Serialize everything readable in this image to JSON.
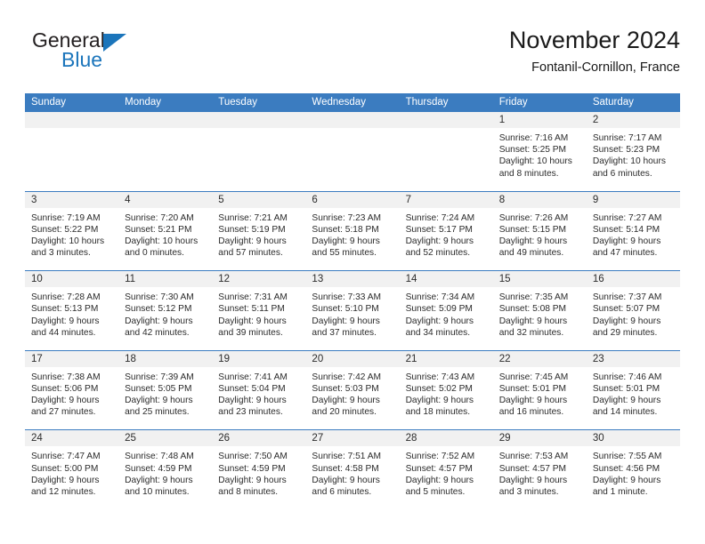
{
  "brand": {
    "name_part1": "General",
    "name_part2": "Blue",
    "accent_color": "#1b75bb",
    "logo_icon": "triangle-flag-icon"
  },
  "header": {
    "title": "November 2024",
    "subtitle": "Fontanil-Cornillon, France"
  },
  "theme": {
    "header_blue": "#3b7cc0",
    "day_band_gray": "#f1f1f1",
    "text": "#2b2b2b"
  },
  "weekdays": [
    "Sunday",
    "Monday",
    "Tuesday",
    "Wednesday",
    "Thursday",
    "Friday",
    "Saturday"
  ],
  "weeks": [
    [
      {
        "day": "",
        "empty": true
      },
      {
        "day": "",
        "empty": true
      },
      {
        "day": "",
        "empty": true
      },
      {
        "day": "",
        "empty": true
      },
      {
        "day": "",
        "empty": true
      },
      {
        "day": "1",
        "sunrise": "Sunrise: 7:16 AM",
        "sunset": "Sunset: 5:25 PM",
        "daylight_line1": "Daylight: 10 hours",
        "daylight_line2": "and 8 minutes."
      },
      {
        "day": "2",
        "sunrise": "Sunrise: 7:17 AM",
        "sunset": "Sunset: 5:23 PM",
        "daylight_line1": "Daylight: 10 hours",
        "daylight_line2": "and 6 minutes."
      }
    ],
    [
      {
        "day": "3",
        "sunrise": "Sunrise: 7:19 AM",
        "sunset": "Sunset: 5:22 PM",
        "daylight_line1": "Daylight: 10 hours",
        "daylight_line2": "and 3 minutes."
      },
      {
        "day": "4",
        "sunrise": "Sunrise: 7:20 AM",
        "sunset": "Sunset: 5:21 PM",
        "daylight_line1": "Daylight: 10 hours",
        "daylight_line2": "and 0 minutes."
      },
      {
        "day": "5",
        "sunrise": "Sunrise: 7:21 AM",
        "sunset": "Sunset: 5:19 PM",
        "daylight_line1": "Daylight: 9 hours",
        "daylight_line2": "and 57 minutes."
      },
      {
        "day": "6",
        "sunrise": "Sunrise: 7:23 AM",
        "sunset": "Sunset: 5:18 PM",
        "daylight_line1": "Daylight: 9 hours",
        "daylight_line2": "and 55 minutes."
      },
      {
        "day": "7",
        "sunrise": "Sunrise: 7:24 AM",
        "sunset": "Sunset: 5:17 PM",
        "daylight_line1": "Daylight: 9 hours",
        "daylight_line2": "and 52 minutes."
      },
      {
        "day": "8",
        "sunrise": "Sunrise: 7:26 AM",
        "sunset": "Sunset: 5:15 PM",
        "daylight_line1": "Daylight: 9 hours",
        "daylight_line2": "and 49 minutes."
      },
      {
        "day": "9",
        "sunrise": "Sunrise: 7:27 AM",
        "sunset": "Sunset: 5:14 PM",
        "daylight_line1": "Daylight: 9 hours",
        "daylight_line2": "and 47 minutes."
      }
    ],
    [
      {
        "day": "10",
        "sunrise": "Sunrise: 7:28 AM",
        "sunset": "Sunset: 5:13 PM",
        "daylight_line1": "Daylight: 9 hours",
        "daylight_line2": "and 44 minutes."
      },
      {
        "day": "11",
        "sunrise": "Sunrise: 7:30 AM",
        "sunset": "Sunset: 5:12 PM",
        "daylight_line1": "Daylight: 9 hours",
        "daylight_line2": "and 42 minutes."
      },
      {
        "day": "12",
        "sunrise": "Sunrise: 7:31 AM",
        "sunset": "Sunset: 5:11 PM",
        "daylight_line1": "Daylight: 9 hours",
        "daylight_line2": "and 39 minutes."
      },
      {
        "day": "13",
        "sunrise": "Sunrise: 7:33 AM",
        "sunset": "Sunset: 5:10 PM",
        "daylight_line1": "Daylight: 9 hours",
        "daylight_line2": "and 37 minutes."
      },
      {
        "day": "14",
        "sunrise": "Sunrise: 7:34 AM",
        "sunset": "Sunset: 5:09 PM",
        "daylight_line1": "Daylight: 9 hours",
        "daylight_line2": "and 34 minutes."
      },
      {
        "day": "15",
        "sunrise": "Sunrise: 7:35 AM",
        "sunset": "Sunset: 5:08 PM",
        "daylight_line1": "Daylight: 9 hours",
        "daylight_line2": "and 32 minutes."
      },
      {
        "day": "16",
        "sunrise": "Sunrise: 7:37 AM",
        "sunset": "Sunset: 5:07 PM",
        "daylight_line1": "Daylight: 9 hours",
        "daylight_line2": "and 29 minutes."
      }
    ],
    [
      {
        "day": "17",
        "sunrise": "Sunrise: 7:38 AM",
        "sunset": "Sunset: 5:06 PM",
        "daylight_line1": "Daylight: 9 hours",
        "daylight_line2": "and 27 minutes."
      },
      {
        "day": "18",
        "sunrise": "Sunrise: 7:39 AM",
        "sunset": "Sunset: 5:05 PM",
        "daylight_line1": "Daylight: 9 hours",
        "daylight_line2": "and 25 minutes."
      },
      {
        "day": "19",
        "sunrise": "Sunrise: 7:41 AM",
        "sunset": "Sunset: 5:04 PM",
        "daylight_line1": "Daylight: 9 hours",
        "daylight_line2": "and 23 minutes."
      },
      {
        "day": "20",
        "sunrise": "Sunrise: 7:42 AM",
        "sunset": "Sunset: 5:03 PM",
        "daylight_line1": "Daylight: 9 hours",
        "daylight_line2": "and 20 minutes."
      },
      {
        "day": "21",
        "sunrise": "Sunrise: 7:43 AM",
        "sunset": "Sunset: 5:02 PM",
        "daylight_line1": "Daylight: 9 hours",
        "daylight_line2": "and 18 minutes."
      },
      {
        "day": "22",
        "sunrise": "Sunrise: 7:45 AM",
        "sunset": "Sunset: 5:01 PM",
        "daylight_line1": "Daylight: 9 hours",
        "daylight_line2": "and 16 minutes."
      },
      {
        "day": "23",
        "sunrise": "Sunrise: 7:46 AM",
        "sunset": "Sunset: 5:01 PM",
        "daylight_line1": "Daylight: 9 hours",
        "daylight_line2": "and 14 minutes."
      }
    ],
    [
      {
        "day": "24",
        "sunrise": "Sunrise: 7:47 AM",
        "sunset": "Sunset: 5:00 PM",
        "daylight_line1": "Daylight: 9 hours",
        "daylight_line2": "and 12 minutes."
      },
      {
        "day": "25",
        "sunrise": "Sunrise: 7:48 AM",
        "sunset": "Sunset: 4:59 PM",
        "daylight_line1": "Daylight: 9 hours",
        "daylight_line2": "and 10 minutes."
      },
      {
        "day": "26",
        "sunrise": "Sunrise: 7:50 AM",
        "sunset": "Sunset: 4:59 PM",
        "daylight_line1": "Daylight: 9 hours",
        "daylight_line2": "and 8 minutes."
      },
      {
        "day": "27",
        "sunrise": "Sunrise: 7:51 AM",
        "sunset": "Sunset: 4:58 PM",
        "daylight_line1": "Daylight: 9 hours",
        "daylight_line2": "and 6 minutes."
      },
      {
        "day": "28",
        "sunrise": "Sunrise: 7:52 AM",
        "sunset": "Sunset: 4:57 PM",
        "daylight_line1": "Daylight: 9 hours",
        "daylight_line2": "and 5 minutes."
      },
      {
        "day": "29",
        "sunrise": "Sunrise: 7:53 AM",
        "sunset": "Sunset: 4:57 PM",
        "daylight_line1": "Daylight: 9 hours",
        "daylight_line2": "and 3 minutes."
      },
      {
        "day": "30",
        "sunrise": "Sunrise: 7:55 AM",
        "sunset": "Sunset: 4:56 PM",
        "daylight_line1": "Daylight: 9 hours",
        "daylight_line2": "and 1 minute."
      }
    ]
  ]
}
